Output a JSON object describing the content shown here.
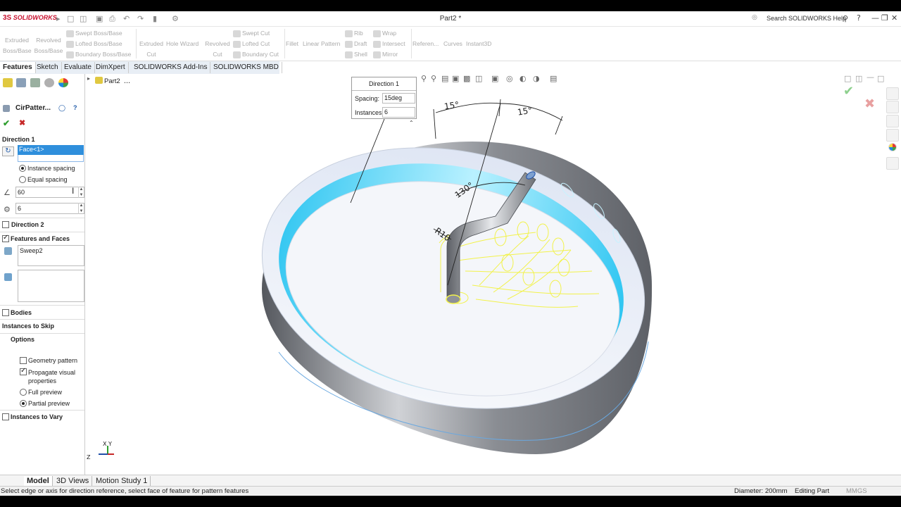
{
  "app": {
    "logo_text": "SOLIDWORKS",
    "document_title": "Part2 *",
    "help_search": "Search SOLIDWORKS Help"
  },
  "ribbon": {
    "items": [
      {
        "label": "Extruded\nBoss/Base"
      },
      {
        "label": "Revolved\nBoss/Base"
      },
      {
        "label": "Swept Boss/Base"
      },
      {
        "label": "Lofted Boss/Base"
      },
      {
        "label": "Boundary Boss/Base"
      },
      {
        "label": "Extruded\nCut"
      },
      {
        "label": "Hole Wizard"
      },
      {
        "label": "Revolved\nCut"
      },
      {
        "label": "Swept Cut"
      },
      {
        "label": "Lofted Cut"
      },
      {
        "label": "Boundary Cut"
      },
      {
        "label": "Fillet"
      },
      {
        "label": "Linear Pattern"
      },
      {
        "label": "Rib"
      },
      {
        "label": "Wrap"
      },
      {
        "label": "Draft"
      },
      {
        "label": "Intersect"
      },
      {
        "label": "Shell"
      },
      {
        "label": "Mirror"
      },
      {
        "label": "Referen..."
      },
      {
        "label": "Curves"
      },
      {
        "label": "Instant3D"
      }
    ]
  },
  "tabs": [
    "Features",
    "Sketch",
    "Evaluate",
    "DimXpert",
    "SOLIDWORKS Add-Ins",
    "SOLIDWORKS MBD"
  ],
  "property_manager": {
    "title": "CirPatter...",
    "direction1": {
      "title": "Direction 1",
      "reference": "Face<1>",
      "options": [
        "Instance spacing",
        "Equal spacing"
      ],
      "selected_option": "Instance spacing",
      "angle_value": "60",
      "instances_value": "6"
    },
    "direction2": {
      "title": "Direction 2",
      "checked": false
    },
    "features_faces": {
      "title": "Features and Faces",
      "checked": true,
      "feature": "Sweep2"
    },
    "bodies": {
      "title": "Bodies",
      "checked": false
    },
    "instances_to_skip": {
      "title": "Instances to Skip"
    },
    "options": {
      "title": "Options",
      "geometry_pattern": {
        "label": "Geometry pattern",
        "checked": false
      },
      "propagate": {
        "label": "Propagate visual\nproperties",
        "checked": true
      },
      "full_preview": {
        "label": "Full preview",
        "selected": false
      },
      "partial_preview": {
        "label": "Partial preview",
        "selected": true
      }
    },
    "instances_to_vary": {
      "title": "Instances to Vary",
      "checked": false
    }
  },
  "tree": {
    "part_name": "Part2",
    "ellipsis": "..."
  },
  "callout": {
    "title": "Direction 1",
    "spacing_label": "Spacing:",
    "spacing_value": "15deg",
    "instances_label": "Instances:",
    "instances_value": "6"
  },
  "dimensions": {
    "d1": "15°",
    "d2": "15°",
    "d3": "130°",
    "d4": "R10"
  },
  "triad": {
    "x": "X",
    "y": "Y",
    "z": "Z"
  },
  "bottom_tabs": [
    "Model",
    "3D Views",
    "Motion Study 1"
  ],
  "status": {
    "message": "Select edge or axis for direction reference, select face of feature for pattern features",
    "diameter": "Diameter: 200mm",
    "mode": "Editing Part",
    "units": "MMGS"
  },
  "colors": {
    "accent_blue": "#2f8fdc",
    "preview_yellow": "#f2f24a",
    "face_cyan": "#29d4f7",
    "confirm_green": "#2e9e2e",
    "cancel_red": "#c62828"
  }
}
